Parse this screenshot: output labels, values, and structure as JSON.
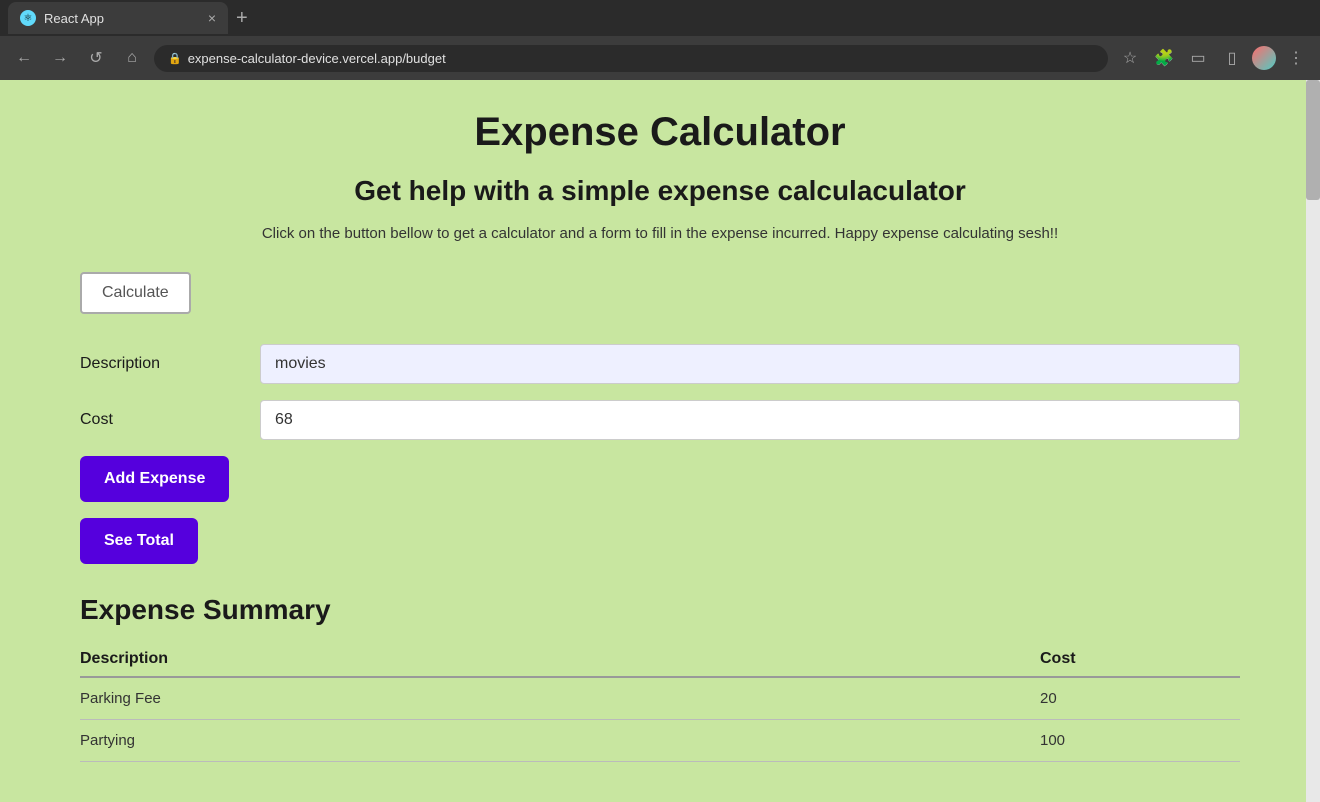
{
  "browser": {
    "tab_title": "React App",
    "tab_favicon": "⚛",
    "url": "expense-calculator-device.vercel.app/budget",
    "new_tab_icon": "+",
    "close_icon": "×"
  },
  "nav": {
    "back": "←",
    "forward": "→",
    "refresh": "↺",
    "home": "⌂"
  },
  "toolbar_icons": {
    "extensions": "⬛",
    "cast": "▭",
    "more": "⋮"
  },
  "page": {
    "main_title": "Expense Calculator",
    "sub_title": "Get help with a simple expense calculaculator",
    "description": "Click on the button bellow to get a calculator and a form to fill in the expense incurred. Happy expense calculating sesh!!",
    "calculate_btn": "Calculate",
    "description_label": "Description",
    "description_value": "movies",
    "cost_label": "Cost",
    "cost_value": "68",
    "add_expense_btn": "Add Expense",
    "see_total_btn": "See Total",
    "summary_title": "Expense Summary",
    "table": {
      "col_description": "Description",
      "col_cost": "Cost",
      "rows": [
        {
          "description": "Parking Fee",
          "cost": "20"
        },
        {
          "description": "Partying",
          "cost": "100"
        }
      ]
    }
  },
  "colors": {
    "bg": "#c8e6a0",
    "accent_btn": "#5500dd",
    "input_description_bg": "#eef0ff",
    "input_cost_bg": "#ffffff"
  }
}
